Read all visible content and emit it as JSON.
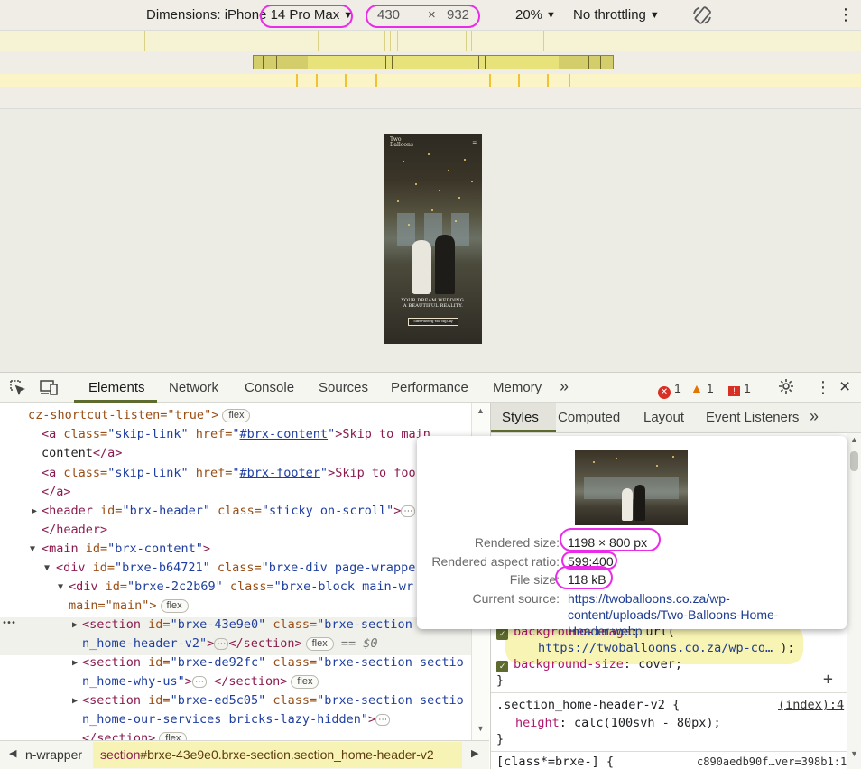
{
  "device_toolbar": {
    "dimensions_label": "Dimensions: iPhone 14 Pro Max",
    "width": "430",
    "times": "×",
    "height": "932",
    "zoom": "20%",
    "throttling": "No throttling",
    "caret": "▼",
    "rotate_icon": "rotate-icon",
    "more_icon": "⋮"
  },
  "phone_preview": {
    "logo_line1": "Two",
    "logo_line2": "Balloons",
    "headline_line1": "YOUR DREAM WEDDING.",
    "headline_line2": "A BEAUTIFUL REALITY.",
    "cta": "Start Planning Your Big Day",
    "menu_icon": "≡"
  },
  "devtools_tabs": {
    "items": [
      "Elements",
      "Network",
      "Console",
      "Sources",
      "Performance",
      "Memory"
    ],
    "more": "»",
    "errors": "1",
    "warnings": "1",
    "issues": "1",
    "close": "×"
  },
  "elements": {
    "rows": {
      "r0": "cz-shortcut-listen=\"true\">",
      "r1_tag_open": "<a",
      "r1_attr": "class=",
      "r1_val": "\"skip-link\"",
      "r1_attr2": "href=",
      "r1_link": "#brx-content",
      "r1_text": ">Skip to main",
      "r2_text": "content",
      "r2_close": "</a>",
      "r3_tag_open": "<a",
      "r3_attr": "class=",
      "r3_val": "\"skip-link\"",
      "r3_attr2": "href=",
      "r3_link": "#brx-footer",
      "r3_text": ">Skip to foo",
      "r4_close": "</a>",
      "r5_tag": "<header",
      "r5_attr": "id=",
      "r5_val": "\"brx-header\"",
      "r5_attr2": "class=",
      "r5_val2": "\"sticky on-scroll\"",
      "r5_end": ">",
      "r6_close": "</header>",
      "r7_tag": "<main",
      "r7_attr": "id=",
      "r7_val": "\"brx-content\"",
      "r7_end": ">",
      "r8_tag": "<div",
      "r8_attr": "id=",
      "r8_val": "\"brxe-b64721\"",
      "r8_attr2": "class=",
      "r8_val2": "\"brxe-div page-wrappe",
      "r9_tag": "<div",
      "r9_attr": "id=",
      "r9_val": "\"brxe-2c2b69\"",
      "r9_attr2": "class=",
      "r9_val2": "\"brxe-block main-wr",
      "r10_text": "main=\"main\">",
      "r11_tag": "<section",
      "r11_attr": "id=",
      "r11_val": "\"brxe-43e9e0\"",
      "r11_attr2": "class=",
      "r11_val2": "\"brxe-section",
      "r12_val": "n_home-header-v2\"",
      "r12_end": ">",
      "r12_close": "</section>",
      "r12_dollar": "== $0",
      "r13_tag": "<section",
      "r13_attr": "id=",
      "r13_val": "\"brxe-de92fc\"",
      "r13_attr2": "class=",
      "r13_val2": "\"brxe-section sectio",
      "r14_val": "n_home-why-us\"",
      "r14_end": ">",
      "r14_close": "</section>",
      "r15_tag": "<section",
      "r15_attr": "id=",
      "r15_val": "\"brxe-ed5c05\"",
      "r15_attr2": "class=",
      "r15_val2": "\"brxe-section sectio",
      "r16_val": "n_home-our-services bricks-lazy-hidden\"",
      "r16_end": ">",
      "r17_close": "</section>"
    },
    "flex": "flex",
    "ellipsis": "⋯",
    "gutter_dots": "•••"
  },
  "breadcrumb": {
    "prev": "n-wrapper",
    "selected_tag": "section",
    "selected_rest": "#brxe-43e9e0.brxe-section.section_home-header-v2"
  },
  "styles_tabs": {
    "items": [
      "Styles",
      "Computed",
      "Layout",
      "Event Listeners"
    ],
    "more": "»"
  },
  "styles": {
    "bg_prop": "background-image",
    "bg_fn": "url(",
    "bg_url": "https://twoballoons.co.za/wp-co…",
    "bg_end": ");",
    "bs_prop": "background-size",
    "bs_val": "cover;",
    "close1": "}",
    "rule2_selector": ".section_home-header-v2 {",
    "rule2_source": "(index):4",
    "height_prop": "height",
    "height_val": "calc(100svh - 80px);",
    "close2": "}",
    "rule3_selector": "[class*=brxe-] {",
    "rule3_source": "c890aedb90f…ver=398b1:1",
    "add": "+"
  },
  "tooltip": {
    "rendered_size_label": "Rendered size:",
    "rendered_size": "1198 × 800 px",
    "aspect_label": "Rendered aspect ratio:",
    "aspect": "599:400",
    "file_size_label": "File size:",
    "file_size": "118 kB",
    "source_label": "Current source:",
    "source": "https://twoballoons.co.za/wp-content/uploads/Two-Balloons-Home-Header.webp"
  },
  "colors": {
    "annotation": "#ea2ce8",
    "highlight_yellow": "#f6f0a4",
    "accent_olive": "#5e6b2e"
  }
}
